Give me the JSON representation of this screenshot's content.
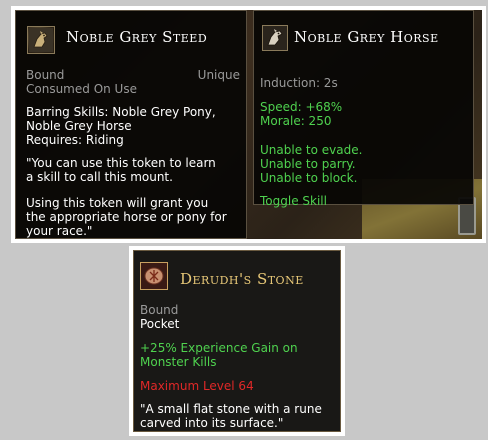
{
  "tooltips": {
    "steed": {
      "title": "Noble Grey Steed",
      "bound": "Bound",
      "unique": "Unique",
      "consumed": "Consumed On Use",
      "barring_line1": "Barring Skills: Noble Grey Pony,",
      "barring_line2": "Noble Grey Horse",
      "requires": "Requires: Riding",
      "desc1_line1": "\"You can use this token to learn",
      "desc1_line2": "a skill to call this mount.",
      "desc2_line1": "Using this token will grant you",
      "desc2_line2": "the appropriate horse or pony for",
      "desc2_line3": "your race.\"",
      "icon": "horse-token-icon"
    },
    "horse": {
      "title": "Noble Grey Horse",
      "induction": "Induction: 2s",
      "speed": "Speed: +68%",
      "morale": "Morale: 250",
      "evade": "Unable to evade.",
      "parry": "Unable to parry.",
      "block": "Unable to block.",
      "toggle": "Toggle Skill",
      "icon": "horse-head-icon"
    },
    "stone": {
      "title": "Derudh's Stone",
      "bound": "Bound",
      "pocket": "Pocket",
      "xp_line1": "+25% Experience Gain on",
      "xp_line2": "Monster Kills",
      "max_level": "Maximum Level 64",
      "desc_line1": "\"A small flat stone with a rune",
      "desc_line2": "carved into its surface.\"",
      "icon": "rune-stone-icon"
    }
  },
  "colors": {
    "title": "#ffffff",
    "grey_text": "#9a9a9a",
    "green_text": "#4fd24f",
    "red_text": "#e02828",
    "stone_title": "#e8c878"
  }
}
